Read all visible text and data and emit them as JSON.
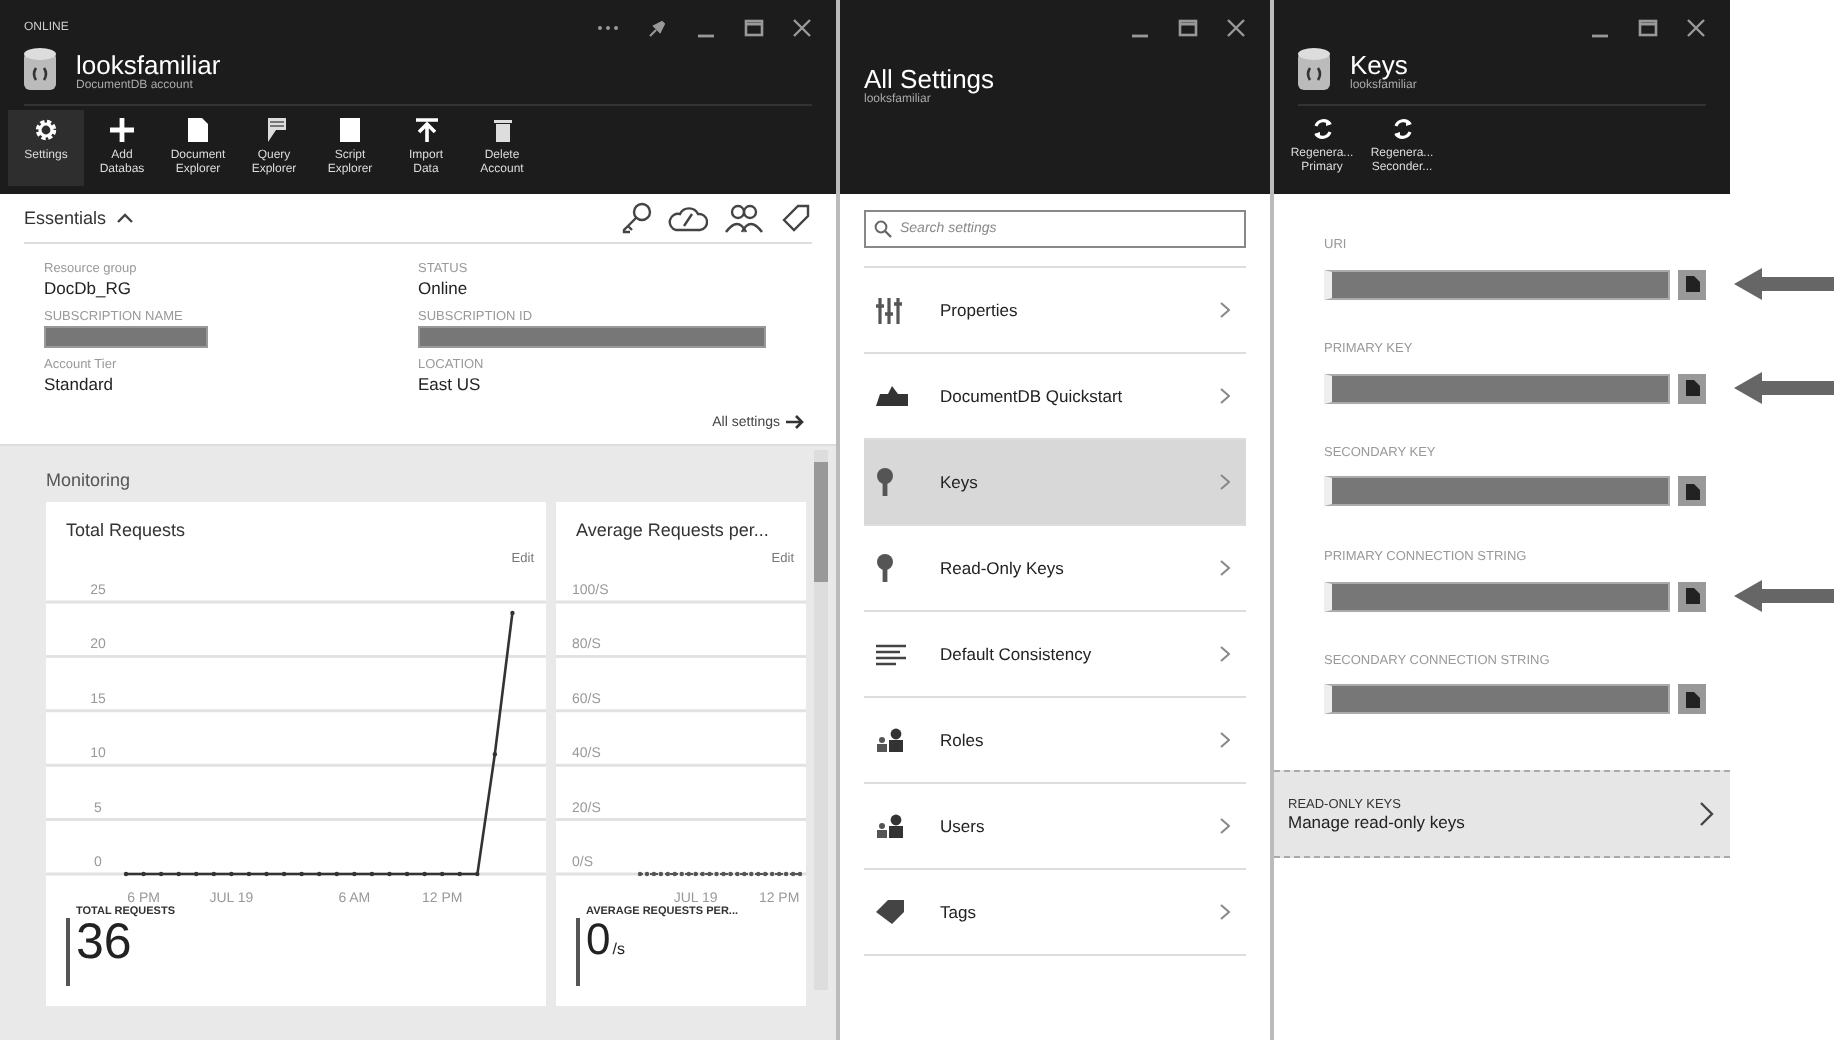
{
  "main_blade": {
    "status": "ONLINE",
    "title": "looksfamiliar",
    "subtitle": "DocumentDB account",
    "toolbar": [
      {
        "lines": [
          "Settings"
        ],
        "selected": true
      },
      {
        "lines": [
          "Add",
          "Databas"
        ],
        "selected": false
      },
      {
        "lines": [
          "Document",
          "Explorer"
        ],
        "selected": false
      },
      {
        "lines": [
          "Query",
          "Explorer"
        ],
        "selected": false
      },
      {
        "lines": [
          "Script",
          "Explorer"
        ],
        "selected": false
      },
      {
        "lines": [
          "Import",
          "Data"
        ],
        "selected": false
      },
      {
        "lines": [
          "Delete",
          "Account"
        ],
        "selected": false
      }
    ],
    "essentials": {
      "heading": "Essentials",
      "expanded": true,
      "properties": [
        {
          "label": "Resource group",
          "value": "DocDb_RG"
        },
        {
          "label": "STATUS",
          "value": "Online"
        },
        {
          "label": "SUBSCRIPTION NAME",
          "redacted": true
        },
        {
          "label": "SUBSCRIPTION ID",
          "redacted": true
        },
        {
          "label": "Account Tier",
          "value": "Standard"
        },
        {
          "label": "LOCATION",
          "value": "East US"
        }
      ],
      "link": "All settings"
    },
    "monitoring": {
      "heading": "Monitoring",
      "tiles": [
        {
          "title": "Total Requests",
          "edit": "Edit",
          "stat_label": "TOTAL REQUESTS",
          "stat_value": "36",
          "chart_data": {
            "type": "line",
            "categories": [
              null,
              "6 PM",
              null,
              null,
              null,
              null,
              "JUL 19",
              null,
              null,
              null,
              null,
              null,
              null,
              "6 AM",
              null,
              null,
              null,
              null,
              "12 PM",
              null,
              null,
              null,
              null,
              null
            ],
            "series": [
              {
                "color": "#333333",
                "line_style": "solid",
                "values": [
                  0,
                  0,
                  0,
                  0,
                  0,
                  0,
                  0,
                  0,
                  0,
                  0,
                  0,
                  0,
                  0,
                  0,
                  0,
                  0,
                  0,
                  0,
                  0,
                  0,
                  0,
                  11,
                  24,
                  null
                ]
              }
            ],
            "ylim": [
              0,
              25
            ],
            "grid": true,
            "yticks": [
              0,
              5,
              10,
              15,
              20,
              25
            ]
          }
        },
        {
          "title": "Average Requests per...",
          "edit": "Edit",
          "stat_label": "AVERAGE REQUESTS PER...",
          "stat_value": "0",
          "stat_unit": "/s",
          "chart_data": {
            "type": "line",
            "categories": [
              null,
              null,
              null,
              null,
              null,
              null,
              null,
              null,
              "JUL 19",
              null,
              null,
              null,
              null,
              null,
              null,
              null,
              null,
              null,
              null,
              null,
              "12 PM",
              null,
              null,
              null
            ],
            "series": [
              {
                "color": "#555555",
                "line_style": "dotted",
                "values": [
                  0,
                  0,
                  0,
                  0,
                  0,
                  0,
                  0,
                  0,
                  0,
                  0,
                  0,
                  0,
                  0,
                  0,
                  0,
                  0,
                  0,
                  0,
                  0,
                  0,
                  0,
                  0,
                  0,
                  0
                ]
              }
            ],
            "ylim": [
              0,
              100
            ],
            "grid": true,
            "yticks": [
              {
                "value": 0,
                "label": "0/S"
              },
              {
                "value": 20,
                "label": "20/S"
              },
              {
                "value": 40,
                "label": "40/S"
              },
              {
                "value": 60,
                "label": "60/S"
              },
              {
                "value": 80,
                "label": "80/S"
              },
              {
                "value": 100,
                "label": "100/S"
              }
            ]
          }
        }
      ]
    }
  },
  "settings_blade": {
    "title": "All Settings",
    "subtitle": "looksfamiliar",
    "search": {
      "placeholder": "Search settings"
    },
    "items": [
      {
        "label": "Properties",
        "selected": false
      },
      {
        "label": "DocumentDB Quickstart",
        "selected": false
      },
      {
        "label": "Keys",
        "selected": true
      },
      {
        "label": "Read-Only Keys",
        "selected": false
      },
      {
        "label": "Default Consistency",
        "selected": false
      },
      {
        "label": "Roles",
        "selected": false
      },
      {
        "label": "Users",
        "selected": false
      },
      {
        "label": "Tags",
        "selected": false
      }
    ]
  },
  "keys_blade": {
    "title": "Keys",
    "subtitle": "looksfamiliar",
    "toolbar": [
      {
        "lines": [
          "Regenera...",
          "Primary"
        ]
      },
      {
        "lines": [
          "Regenera...",
          "Seconder..."
        ]
      }
    ],
    "fields": [
      {
        "label": "URI",
        "annotated": true
      },
      {
        "label": "PRIMARY KEY",
        "annotated": true
      },
      {
        "label": "SECONDARY KEY",
        "annotated": false
      },
      {
        "label": "PRIMARY CONNECTION STRING",
        "annotated": true
      },
      {
        "label": "SECONDARY CONNECTION STRING",
        "annotated": false
      }
    ],
    "read_only": {
      "heading": "READ-ONLY KEYS",
      "text": "Manage read-only keys"
    }
  }
}
